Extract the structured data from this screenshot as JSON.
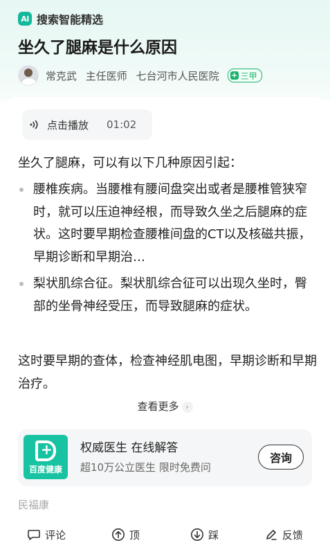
{
  "header": {
    "ai_logo_text": "AI",
    "ai_label": "搜索智能精选",
    "title": "坐久了腿麻是什么原因",
    "author": {
      "name": "常克武",
      "position": "主任医师",
      "hospital": "七台河市人民医院",
      "badge": "三甲"
    }
  },
  "audio": {
    "label": "点击播放",
    "duration": "01:02"
  },
  "article": {
    "intro": "坐久了腿麻，可以有以下几种原因引起：",
    "bullets": [
      "腰椎疾病。当腰椎有腰间盘突出或者是腰椎管狭窄时，就可以压迫神经根，而导致久坐之后腿麻的症状。这时要早期检查腰椎间盘的CT以及核磁共振，早期诊断和早期治…",
      "梨状肌综合征。梨状肌综合征可以出现久坐时，臀部的坐骨神经受压，而导致腿麻的症状。"
    ],
    "tail": "这时要早期的查体，检查神经肌电图，早期诊断和早期治疗。",
    "more": "查看更多"
  },
  "promo": {
    "logo_name": "百度健康",
    "title": "权威医生 在线解答",
    "subtitle": "超10万公立医生 限时免费问",
    "button": "咨询"
  },
  "source": "民福康",
  "actions": {
    "comment": "评论",
    "up": "顶",
    "down": "踩",
    "feedback": "反馈"
  },
  "colors": {
    "accent": "#17c3a2",
    "badge_green": "#19b36b"
  }
}
